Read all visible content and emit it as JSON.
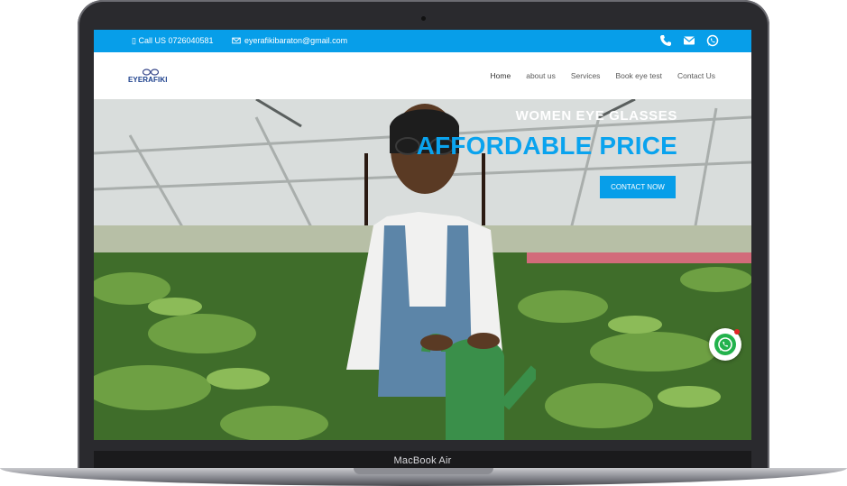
{
  "device": {
    "label": "MacBook Air"
  },
  "topbar": {
    "call": "▯ Call US 0726040581",
    "email": "eyerafikibaraton@gmail.com",
    "icons": [
      "phone-icon",
      "envelope-icon",
      "whatsapp-icon"
    ]
  },
  "brand": {
    "logo_text": "EYERAFIKI"
  },
  "nav": {
    "items": [
      "Home",
      "about us",
      "Services",
      "Book eye test",
      "Contact Us"
    ]
  },
  "hero": {
    "subtitle": "WOMEN EYE GLASSES",
    "title": "AFFORDABLE PRICE",
    "cta": "CONTACT NOW"
  },
  "colors": {
    "accent": "#079ee9",
    "title": "#0aa3ee",
    "whatsapp": "#22b24c"
  }
}
